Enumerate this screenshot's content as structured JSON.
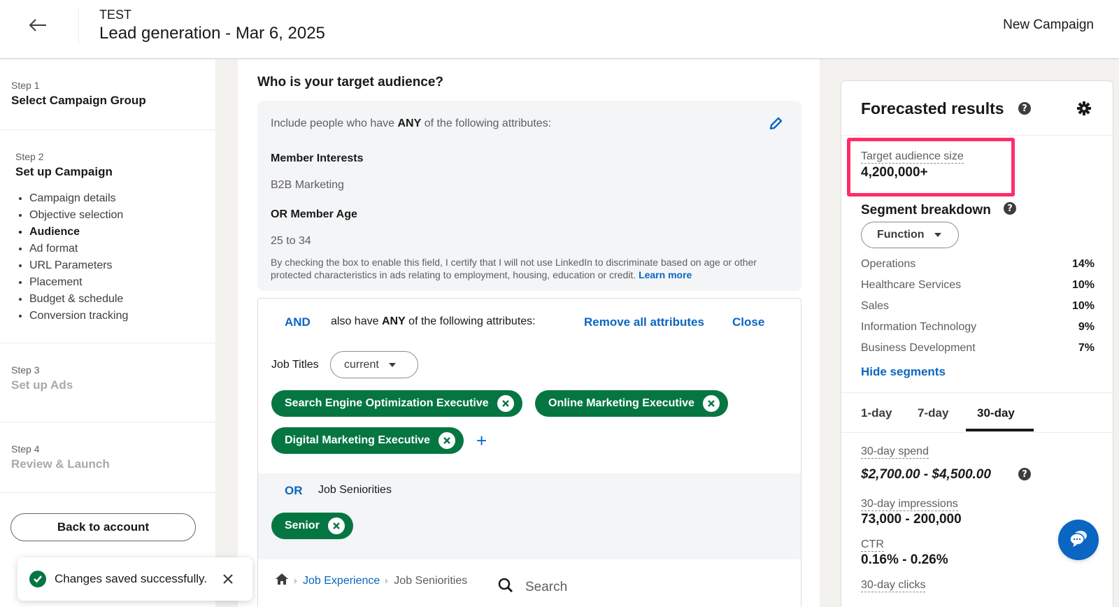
{
  "header": {
    "subtitle": "TEST",
    "title": "Lead generation - Mar 6, 2025",
    "right_label": "New Campaign"
  },
  "sidebar": {
    "steps": [
      {
        "label": "Step 1",
        "title": "Select Campaign Group"
      },
      {
        "label": "Step 2",
        "title": "Set up Campaign",
        "items": [
          {
            "label": "Campaign details"
          },
          {
            "label": "Objective selection"
          },
          {
            "label": "Audience",
            "active": true
          },
          {
            "label": "Ad format"
          },
          {
            "label": "URL Parameters"
          },
          {
            "label": "Placement"
          },
          {
            "label": "Budget & schedule"
          },
          {
            "label": "Conversion tracking"
          }
        ]
      },
      {
        "label": "Step 3",
        "title": "Set up Ads"
      },
      {
        "label": "Step 4",
        "title": "Review & Launch"
      }
    ],
    "back_button": "Back to account"
  },
  "toast": {
    "message": "Changes saved successfully."
  },
  "audience": {
    "question": "Who is your target audience?",
    "include": {
      "prefix": "Include people who have ",
      "emphasis": "ANY",
      "suffix": " of the following attributes:",
      "groups": [
        {
          "title": "Member Interests",
          "value": "B2B Marketing"
        },
        {
          "title": "OR Member Age",
          "value": "25 to 34"
        }
      ],
      "disclaimer": "By checking the box to enable this field, I certify that I will not use LinkedIn to discriminate based on age or other protected characteristics in ads relating to employment, housing, education or credit.",
      "learn_more": "Learn more"
    },
    "and_section": {
      "and_label": "AND",
      "text_prefix": "also have ",
      "text_emphasis": "ANY",
      "text_suffix": " of the following attributes:",
      "remove_all": "Remove all attributes",
      "close": "Close",
      "job_titles_label": "Job Titles",
      "job_titles_filter": "current",
      "job_titles": [
        "Search Engine Optimization Executive",
        "Online Marketing Executive",
        "Digital Marketing Executive"
      ],
      "or_label": "OR",
      "or_text": "Job Seniorities",
      "seniorities": [
        "Senior"
      ]
    },
    "browse": {
      "breadcrumb": [
        "Job Experience",
        "Job Seniorities"
      ],
      "search_placeholder": "Search"
    }
  },
  "forecast": {
    "title": "Forecasted results",
    "target_audience_label": "Target audience size",
    "target_audience_value": "4,200,000+",
    "segment_title": "Segment breakdown",
    "segment_filter": "Function",
    "segments": [
      {
        "name": "Operations",
        "pct": "14%"
      },
      {
        "name": "Healthcare Services",
        "pct": "10%"
      },
      {
        "name": "Sales",
        "pct": "10%"
      },
      {
        "name": "Information Technology",
        "pct": "9%"
      },
      {
        "name": "Business Development",
        "pct": "7%"
      }
    ],
    "hide_segments": "Hide segments",
    "tabs": [
      {
        "label": "1-day"
      },
      {
        "label": "7-day"
      },
      {
        "label": "30-day",
        "active": true
      }
    ],
    "metrics": [
      {
        "label": "30-day spend",
        "value": "$2,700.00 - $4,500.00"
      },
      {
        "label": "30-day impressions",
        "value": "73,000 - 200,000"
      },
      {
        "label": "CTR",
        "value": "0.16% - 0.26%"
      },
      {
        "label": "30-day clicks",
        "value": ""
      }
    ]
  },
  "colors": {
    "brand_blue": "#0a66c2",
    "pill_green": "#057642",
    "highlight_pink": "#ff2c6a"
  }
}
